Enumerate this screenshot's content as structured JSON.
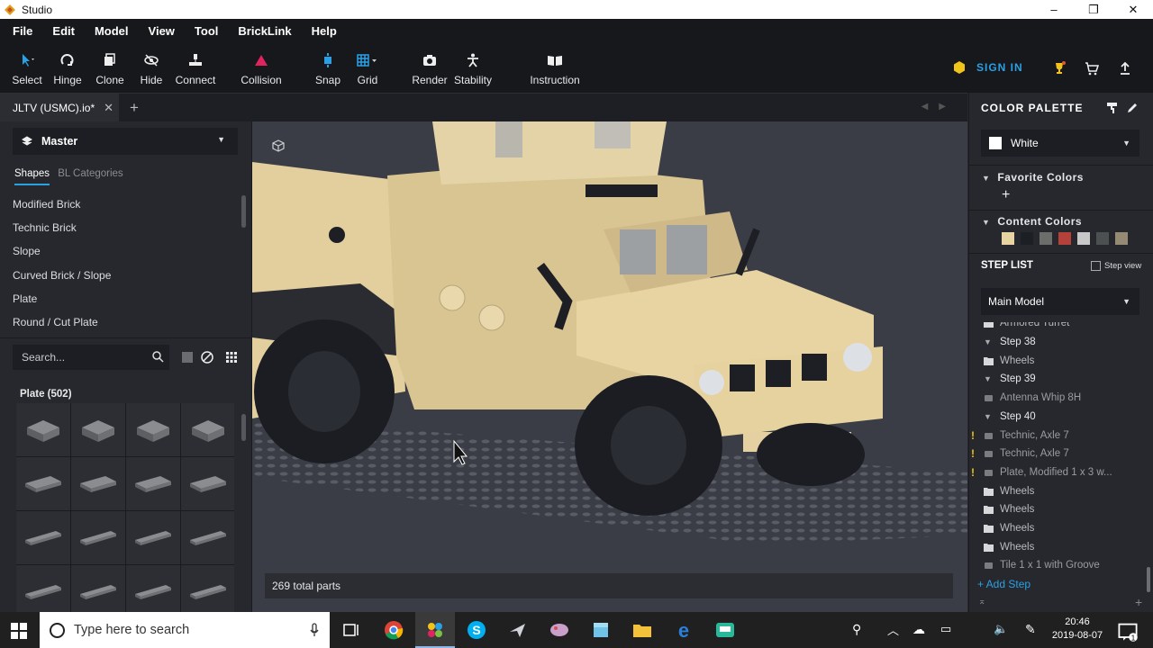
{
  "window": {
    "title": "Studio",
    "controls": [
      "–",
      "❐",
      "✕"
    ]
  },
  "menu": [
    "File",
    "Edit",
    "Model",
    "View",
    "Tool",
    "BrickLink",
    "Help"
  ],
  "toolbar": {
    "select": "Select",
    "hinge": "Hinge",
    "clone": "Clone",
    "hide": "Hide",
    "connect": "Connect",
    "collision": "Collision",
    "snap": "Snap",
    "grid": "Grid",
    "render": "Render",
    "stability": "Stability",
    "instruction": "Instruction",
    "sign_in": "SIGN IN"
  },
  "tabs": {
    "document": "JLTV (USMC).io*",
    "close": "✕",
    "add": "+"
  },
  "left_panel": {
    "model_selector": "Master",
    "shape_tab": "Shapes",
    "bl_tab": "BL Categories",
    "categories": [
      "Modified Brick",
      "Technic Brick",
      "Slope",
      "Curved Brick / Slope",
      "Plate",
      "Round / Cut Plate"
    ],
    "search_placeholder": "Search...",
    "parts_header": "Plate (502)"
  },
  "viewport": {
    "total_parts": "269 total parts"
  },
  "right_panel": {
    "color_palette_title": "COLOR PALETTE",
    "selected_color": "White",
    "favorite_colors": "Favorite Colors",
    "add_favorite": "+",
    "content_colors": "Content Colors",
    "content_swatches": [
      "#e8d3a3",
      "#1c1f24",
      "#6c6e6b",
      "#b4423a",
      "#c8c8c8",
      "#4d5050",
      "#958a73"
    ],
    "step_list_title": "STEP LIST",
    "step_view": "Step view",
    "model_selector": "Main Model",
    "steps": [
      {
        "kind": "group",
        "text": "Armored Turret"
      },
      {
        "kind": "step",
        "text": "Step 38"
      },
      {
        "kind": "group",
        "text": "Wheels"
      },
      {
        "kind": "step",
        "text": "Step 39"
      },
      {
        "kind": "part",
        "text": "Antenna Whip 8H"
      },
      {
        "kind": "step",
        "text": "Step 40"
      },
      {
        "kind": "part",
        "text": "Technic, Axle 7",
        "warn": "!"
      },
      {
        "kind": "part",
        "text": "Technic, Axle 7",
        "warn": "!"
      },
      {
        "kind": "part",
        "text": "Plate, Modified 1 x 3 w...",
        "warn": "!"
      },
      {
        "kind": "group",
        "text": "Wheels"
      },
      {
        "kind": "group",
        "text": "Wheels"
      },
      {
        "kind": "group",
        "text": "Wheels"
      },
      {
        "kind": "group",
        "text": "Wheels"
      },
      {
        "kind": "part",
        "text": "Tile 1 x 1 with Groove"
      }
    ],
    "add_step": "+ Add Step"
  },
  "taskbar": {
    "search_placeholder": "Type here to search",
    "time": "20:46",
    "date": "2019-08-07"
  }
}
